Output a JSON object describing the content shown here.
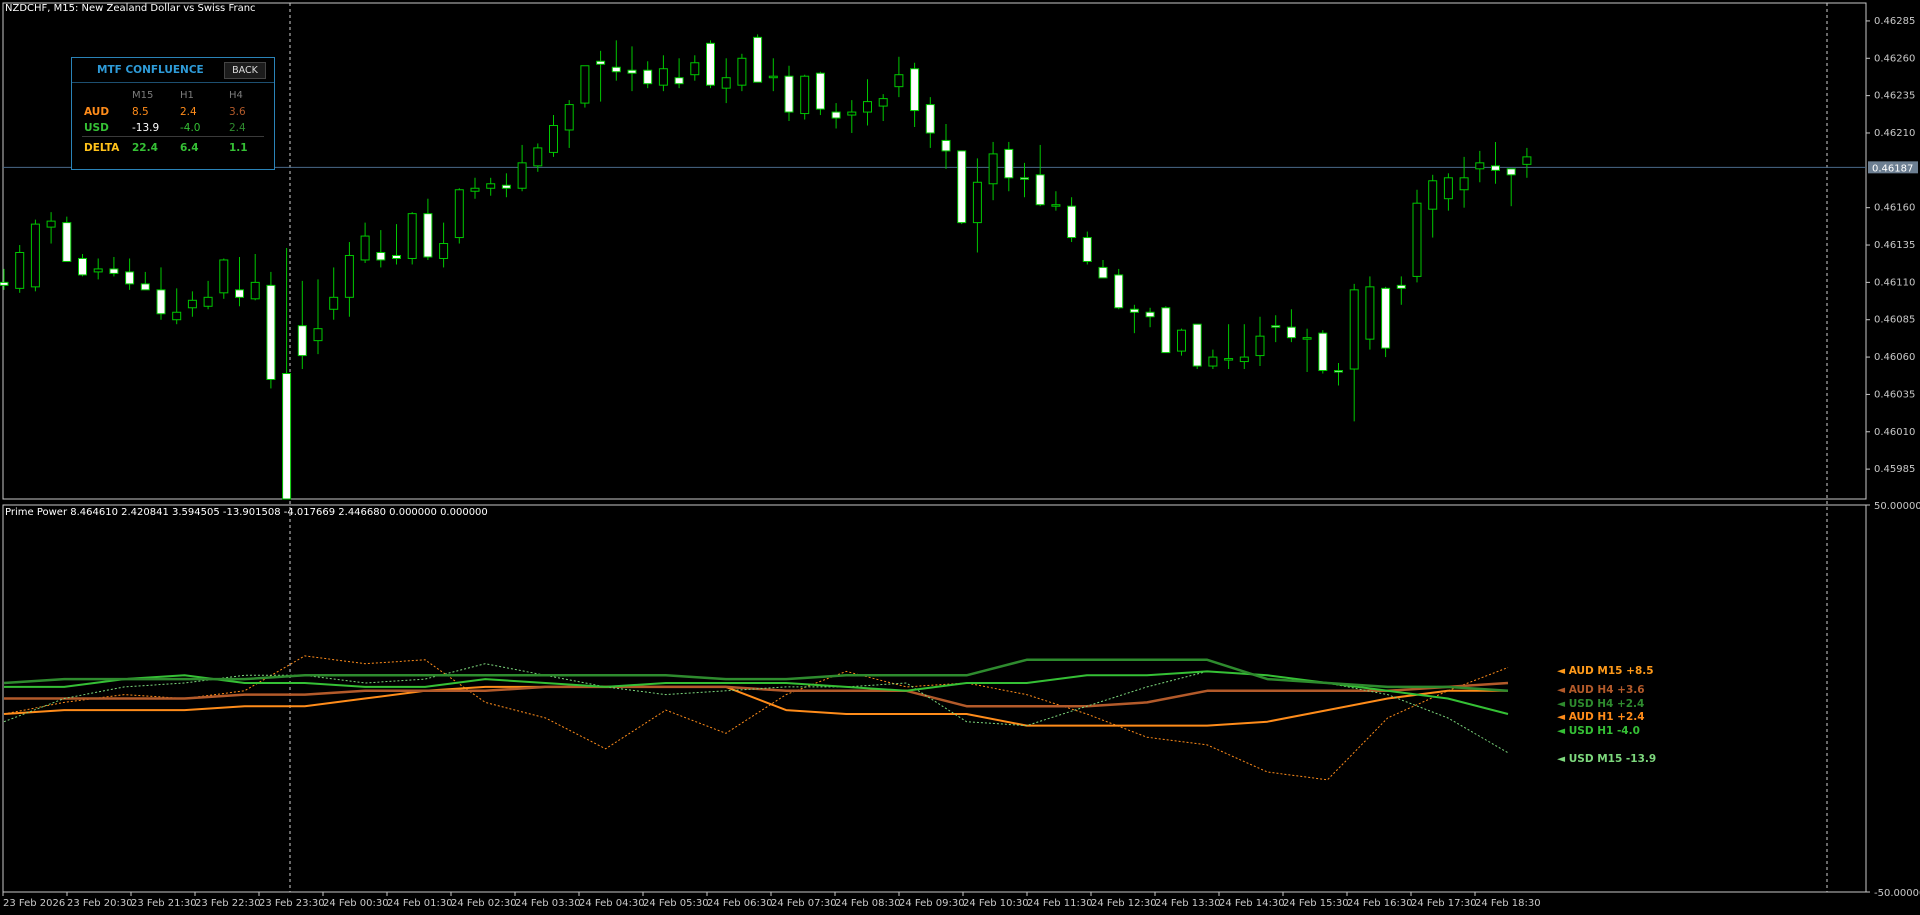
{
  "chart_title": "NZDCHF, M15:  New Zealand Dollar vs Swiss Franc",
  "indicator_title": "Prime Power 8.464610 2.420841 3.594505 -13.901508 -4.017669 2.446680 0.000000 0.000000",
  "current_price": "0.46187",
  "mtf_panel": {
    "title": "MTF CONFLUENCE",
    "back_label": "BACK",
    "columns": [
      "M15",
      "H1",
      "H4"
    ],
    "rows": [
      {
        "label": "AUD",
        "values": [
          "8.5",
          "2.4",
          "3.6"
        ],
        "color": "#ff8c1a",
        "value_colors": [
          "#ff8c1a",
          "#ff8c1a",
          "#b35a2a"
        ]
      },
      {
        "label": "USD",
        "values": [
          "-13.9",
          "-4.0",
          "2.4"
        ],
        "color": "#35c035",
        "value_colors": [
          "#ffffff",
          "#35c035",
          "#2e8b2e"
        ]
      },
      {
        "label": "DELTA",
        "values": [
          "22.4",
          "6.4",
          "1.1"
        ],
        "color": "#ffc21a",
        "value_colors": [
          "#35c035",
          "#35c035",
          "#35c035"
        ]
      }
    ]
  },
  "indicator_labels": [
    {
      "text": "◄ AUD M15 +8.5",
      "color": "#ff9a1a"
    },
    {
      "text": "◄ AUD H4 +3.6",
      "color": "#b35a2a"
    },
    {
      "text": "◄ USD H4 +2.4",
      "color": "#2e8b2e"
    },
    {
      "text": "◄ AUD H1 +2.4",
      "color": "#ff8c1a"
    },
    {
      "text": "◄ USD H1 -4.0",
      "color": "#35c035"
    },
    {
      "text": "◄ USD M15 -13.9",
      "color": "#7dd87d"
    }
  ],
  "colors": {
    "bull_candle": "#ffffff",
    "bear_candle": "#ffffff",
    "wick": "#00c800",
    "axis": "#c8c8c8",
    "grid_line": "#4a6a8a",
    "aud_m15": "#ff8c1a",
    "aud_h1": "#ff8c1a",
    "aud_h4": "#b35a2a",
    "usd_m15": "#7dd87d",
    "usd_h1": "#35c035",
    "usd_h4": "#2e8b2e"
  },
  "chart_data": [
    {
      "type": "candlestick",
      "title": "NZDCHF, M15:  New Zealand Dollar vs Swiss Franc",
      "ylim": [
        0.45965,
        0.46297
      ],
      "y_ticks": [
        "0.46285",
        "0.46260",
        "0.46235",
        "0.46210",
        "0.46160",
        "0.46135",
        "0.46110",
        "0.46085",
        "0.46060",
        "0.46035",
        "0.46010",
        "0.45985"
      ],
      "x_ticks": [
        "23 Feb 2026",
        "23 Feb 20:30",
        "23 Feb 21:30",
        "23 Feb 22:30",
        "23 Feb 23:30",
        "24 Feb 00:30",
        "24 Feb 01:30",
        "24 Feb 02:30",
        "24 Feb 03:30",
        "24 Feb 04:30",
        "24 Feb 05:30",
        "24 Feb 06:30",
        "24 Feb 07:30",
        "24 Feb 08:30",
        "24 Feb 09:30",
        "24 Feb 10:30",
        "24 Feb 11:30",
        "24 Feb 12:30",
        "24 Feb 13:30",
        "24 Feb 14:30",
        "24 Feb 15:30",
        "24 Feb 16:30",
        "24 Feb 17:30",
        "24 Feb 18:30"
      ],
      "current_price": 0.46187,
      "ohlc": [
        [
          0.4611,
          0.46119,
          0.46105,
          0.46108
        ],
        [
          0.46106,
          0.46135,
          0.46103,
          0.4613
        ],
        [
          0.46107,
          0.46152,
          0.46104,
          0.46149
        ],
        [
          0.46147,
          0.46157,
          0.46136,
          0.46151
        ],
        [
          0.4615,
          0.46154,
          0.46126,
          0.46124
        ],
        [
          0.46126,
          0.46129,
          0.46114,
          0.46115
        ],
        [
          0.46117,
          0.46126,
          0.46112,
          0.46119
        ],
        [
          0.46119,
          0.46127,
          0.46114,
          0.46116
        ],
        [
          0.46117,
          0.46126,
          0.46105,
          0.46109
        ],
        [
          0.46109,
          0.46117,
          0.46105,
          0.46105
        ],
        [
          0.46105,
          0.4612,
          0.46085,
          0.46089
        ],
        [
          0.46085,
          0.46106,
          0.46082,
          0.4609
        ],
        [
          0.46093,
          0.46104,
          0.46087,
          0.46098
        ],
        [
          0.46094,
          0.46111,
          0.46092,
          0.461
        ],
        [
          0.46103,
          0.46126,
          0.46099,
          0.46125
        ],
        [
          0.46105,
          0.46127,
          0.46094,
          0.461
        ],
        [
          0.46099,
          0.46129,
          0.46098,
          0.4611
        ],
        [
          0.46108,
          0.46117,
          0.46039,
          0.46045
        ],
        [
          0.46049,
          0.46133,
          0.46005,
          0.45965
        ],
        [
          0.46081,
          0.46111,
          0.46052,
          0.46061
        ],
        [
          0.46071,
          0.46112,
          0.46062,
          0.46079
        ],
        [
          0.46092,
          0.4612,
          0.46085,
          0.461
        ],
        [
          0.461,
          0.46137,
          0.46087,
          0.46128
        ],
        [
          0.46125,
          0.4615,
          0.46123,
          0.46141
        ],
        [
          0.4613,
          0.46145,
          0.4612,
          0.46125
        ],
        [
          0.46128,
          0.46149,
          0.46122,
          0.46126
        ],
        [
          0.46126,
          0.46157,
          0.46122,
          0.46156
        ],
        [
          0.46156,
          0.46166,
          0.46125,
          0.46127
        ],
        [
          0.46126,
          0.4615,
          0.4612,
          0.46136
        ],
        [
          0.4614,
          0.46173,
          0.46136,
          0.46172
        ],
        [
          0.46171,
          0.4618,
          0.46166,
          0.46173
        ],
        [
          0.46173,
          0.4618,
          0.46168,
          0.46176
        ],
        [
          0.46175,
          0.46183,
          0.46167,
          0.46173
        ],
        [
          0.46173,
          0.46202,
          0.46171,
          0.4619
        ],
        [
          0.46188,
          0.46203,
          0.46184,
          0.462
        ],
        [
          0.46197,
          0.46222,
          0.46194,
          0.46215
        ],
        [
          0.46212,
          0.46232,
          0.462,
          0.46229
        ],
        [
          0.4623,
          0.46254,
          0.46227,
          0.46255
        ],
        [
          0.46258,
          0.46265,
          0.46231,
          0.46256
        ],
        [
          0.46254,
          0.46272,
          0.46245,
          0.46251
        ],
        [
          0.46252,
          0.46268,
          0.46238,
          0.4625
        ],
        [
          0.46252,
          0.46258,
          0.4624,
          0.46243
        ],
        [
          0.46242,
          0.46262,
          0.46238,
          0.46253
        ],
        [
          0.46247,
          0.4626,
          0.4624,
          0.46243
        ],
        [
          0.46249,
          0.46262,
          0.46245,
          0.46257
        ],
        [
          0.4627,
          0.46272,
          0.4624,
          0.46242
        ],
        [
          0.4624,
          0.4626,
          0.4623,
          0.46247
        ],
        [
          0.46242,
          0.46263,
          0.46238,
          0.4626
        ],
        [
          0.46274,
          0.46276,
          0.46244,
          0.46244
        ],
        [
          0.46248,
          0.4626,
          0.46238,
          0.46248
        ],
        [
          0.46248,
          0.46255,
          0.46218,
          0.46224
        ],
        [
          0.46223,
          0.46249,
          0.46219,
          0.46248
        ],
        [
          0.4625,
          0.46251,
          0.46222,
          0.46226
        ],
        [
          0.46224,
          0.4623,
          0.46213,
          0.4622
        ],
        [
          0.46222,
          0.46232,
          0.4621,
          0.46224
        ],
        [
          0.46224,
          0.46246,
          0.46215,
          0.46231
        ],
        [
          0.46228,
          0.46236,
          0.46218,
          0.46233
        ],
        [
          0.46241,
          0.46261,
          0.46234,
          0.46249
        ],
        [
          0.46253,
          0.46257,
          0.46214,
          0.46225
        ],
        [
          0.46229,
          0.46234,
          0.462,
          0.4621
        ],
        [
          0.46205,
          0.46216,
          0.46186,
          0.46198
        ],
        [
          0.46198,
          0.46198,
          0.46149,
          0.4615
        ],
        [
          0.4615,
          0.46193,
          0.4613,
          0.46177
        ],
        [
          0.46176,
          0.46204,
          0.46165,
          0.46196
        ],
        [
          0.46199,
          0.46204,
          0.46171,
          0.4618
        ],
        [
          0.4618,
          0.4619,
          0.46167,
          0.46179
        ],
        [
          0.46182,
          0.46202,
          0.46161,
          0.46162
        ],
        [
          0.46162,
          0.46171,
          0.46158,
          0.46162
        ],
        [
          0.46161,
          0.46167,
          0.46137,
          0.4614
        ],
        [
          0.4614,
          0.46144,
          0.46122,
          0.46124
        ],
        [
          0.4612,
          0.46125,
          0.46113,
          0.46113
        ],
        [
          0.46115,
          0.46119,
          0.46092,
          0.46093
        ],
        [
          0.46092,
          0.46095,
          0.46076,
          0.4609
        ],
        [
          0.4609,
          0.46093,
          0.4608,
          0.46087
        ],
        [
          0.46093,
          0.46094,
          0.46063,
          0.46063
        ],
        [
          0.46064,
          0.46079,
          0.46061,
          0.46078
        ],
        [
          0.46082,
          0.46082,
          0.46052,
          0.46054
        ],
        [
          0.46054,
          0.46065,
          0.46052,
          0.4606
        ],
        [
          0.46058,
          0.46082,
          0.46052,
          0.46059
        ],
        [
          0.46057,
          0.46082,
          0.46052,
          0.4606
        ],
        [
          0.46061,
          0.46087,
          0.46054,
          0.46074
        ],
        [
          0.46081,
          0.46088,
          0.4607,
          0.4608
        ],
        [
          0.4608,
          0.46092,
          0.4607,
          0.46073
        ],
        [
          0.46073,
          0.46079,
          0.4605,
          0.46073
        ],
        [
          0.46076,
          0.46078,
          0.46049,
          0.46051
        ],
        [
          0.46051,
          0.46056,
          0.46041,
          0.4605
        ],
        [
          0.46052,
          0.46109,
          0.46017,
          0.46105
        ],
        [
          0.46072,
          0.46114,
          0.46065,
          0.46107
        ],
        [
          0.46106,
          0.46107,
          0.4606,
          0.46066
        ],
        [
          0.46108,
          0.46114,
          0.46095,
          0.46106
        ],
        [
          0.46114,
          0.46172,
          0.4611,
          0.46163
        ],
        [
          0.46159,
          0.46182,
          0.4614,
          0.46178
        ],
        [
          0.46166,
          0.46183,
          0.46158,
          0.4618
        ],
        [
          0.46172,
          0.46194,
          0.4616,
          0.4618
        ],
        [
          0.46186,
          0.46198,
          0.46177,
          0.4619
        ],
        [
          0.46188,
          0.46204,
          0.46176,
          0.46185
        ],
        [
          0.46186,
          0.46186,
          0.46161,
          0.46182
        ],
        [
          0.46189,
          0.462,
          0.4618,
          0.46194
        ]
      ]
    },
    {
      "type": "line",
      "title": "Prime Power 8.464610 2.420841 3.594505 -13.901508 -4.017669 2.446680 0.000000 0.000000",
      "ylim": [
        -50,
        50
      ],
      "y_ticks": [
        "50.000000",
        "-50.000000"
      ],
      "x": [
        0,
        8,
        17,
        26,
        34,
        43,
        52,
        61,
        69,
        78,
        86,
        95
      ],
      "series": [
        {
          "name": "AUD M15 +8.5",
          "values": [
            -4,
            -1,
            1,
            0,
            2,
            11,
            9,
            10,
            -1,
            -5,
            -13,
            -3,
            -9,
            1,
            7,
            3,
            4,
            1,
            -4,
            -10,
            -12,
            -19,
            -21,
            -5,
            2,
            8
          ]
        },
        {
          "name": "AUD H1 +2.4",
          "values": [
            -4,
            -3,
            -3,
            -3,
            -2,
            -2,
            0,
            2,
            3,
            3,
            3,
            3,
            3,
            -3,
            -4,
            -4,
            -4,
            -7,
            -7,
            -7,
            -7,
            -6,
            -3,
            0,
            2,
            2
          ]
        },
        {
          "name": "AUD H4 +3.6",
          "values": [
            0,
            0,
            0,
            0,
            1,
            1,
            2,
            2,
            2,
            3,
            3,
            3,
            3,
            2,
            2,
            2,
            -2,
            -2,
            -2,
            -1,
            2,
            2,
            2,
            2,
            3,
            4
          ]
        },
        {
          "name": "USD M15 -13.9",
          "values": [
            -6,
            0,
            3,
            4,
            6,
            6,
            4,
            5,
            9,
            6,
            3,
            1,
            2,
            3,
            3,
            4,
            -6,
            -7,
            -2,
            3,
            7,
            6,
            4,
            1,
            -5,
            -14
          ]
        },
        {
          "name": "USD H1 -4.0",
          "values": [
            3,
            3,
            5,
            6,
            4,
            4,
            3,
            3,
            5,
            4,
            3,
            4,
            4,
            4,
            3,
            2,
            4,
            4,
            6,
            6,
            7,
            6,
            4,
            2,
            0,
            -4
          ]
        },
        {
          "name": "USD H4 +2.4",
          "values": [
            4,
            5,
            5,
            5,
            5,
            6,
            6,
            6,
            6,
            6,
            6,
            6,
            5,
            5,
            6,
            6,
            6,
            10,
            10,
            10,
            10,
            5,
            4,
            3,
            3,
            2
          ]
        }
      ]
    }
  ]
}
